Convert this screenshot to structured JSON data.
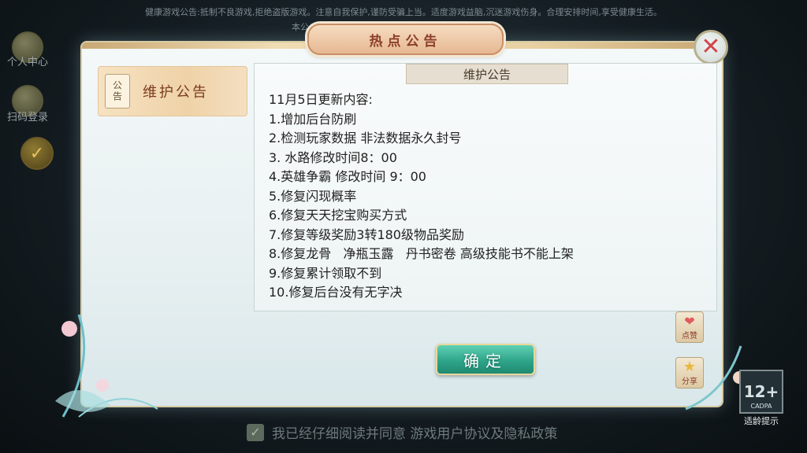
{
  "top_notice": {
    "line1": "健康游戏公告:抵制不良游戏,拒绝盗版游戏。注意自我保护,谨防受骗上当。适度游戏益脑,沉迷游戏伤身。合理安排时间,享受健康生活。",
    "line2_fragment": "本公"
  },
  "side_menu": {
    "personal_center": "个人中心",
    "scan_login": "扫码登录"
  },
  "dialog": {
    "title": "热点公告",
    "tab_badge": "公告",
    "tab_label": "维护公告",
    "content_title": "维护公告",
    "lines": [
      "11月5日更新内容:",
      "1.增加后台防刷",
      "2.检测玩家数据 非法数据永久封号",
      "3. 水路修改时间8：00",
      "4.英雄争霸 修改时间 9：00",
      "5.修复闪现概率",
      "6.修复天天挖宝购买方式",
      "7.修复等级奖励3转180级物品奖励",
      "8.修复龙骨   净瓶玉露   丹书密卷 高级技能书不能上架",
      "9.修复累计领取不到",
      "10.修复后台没有无字决"
    ],
    "confirm_label": "确定",
    "like_label": "点赞",
    "share_label": "分享"
  },
  "agreement": {
    "text": "我已经仔细阅读并同意 游戏用户协议及隐私政策",
    "checked": true
  },
  "age_rating": {
    "value": "12+",
    "org": "CADPA",
    "label": "适龄提示"
  },
  "colors": {
    "title_text": "#8c3f2a",
    "confirm_green": "#2fa58a",
    "close_red": "#d1454b"
  }
}
